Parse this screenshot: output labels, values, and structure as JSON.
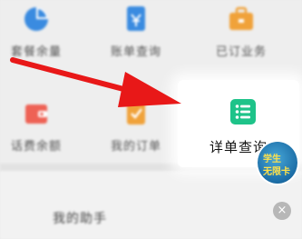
{
  "menu": {
    "items": [
      {
        "label": "套餐余量",
        "icon": "pie-chart-icon",
        "color": "#3a8be0"
      },
      {
        "label": "账单查询",
        "icon": "bill-icon",
        "color": "#3a8be0"
      },
      {
        "label": "已订业务",
        "icon": "briefcase-icon",
        "color": "#f0a23a"
      },
      {
        "label": "话费余额",
        "icon": "wallet-icon",
        "color": "#ee6255"
      },
      {
        "label": "我的订单",
        "icon": "order-icon",
        "color": "#f0a23a"
      },
      {
        "label": "详单查询",
        "icon": "list-icon",
        "color": "#1ec389"
      }
    ]
  },
  "assistant": {
    "title": "我的助手",
    "badge_text": [
      "学生",
      "无限卡"
    ],
    "close_label": "×"
  }
}
